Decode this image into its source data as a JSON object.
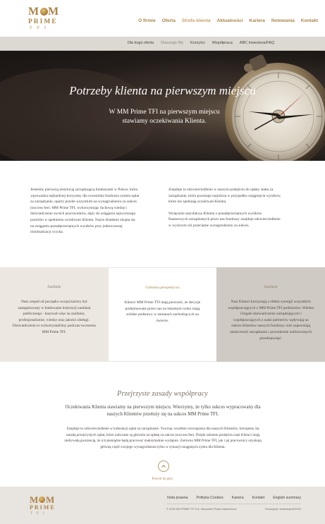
{
  "brand": {
    "logo_m": "M",
    "logo_prime": "PRIME",
    "logo_tfi": "TFI"
  },
  "nav": {
    "items": [
      "O firmie",
      "Oferta",
      "Strefa klienta",
      "Aktualności",
      "Kariera",
      "Notowania",
      "Kontakt"
    ],
    "active": "Strefa klienta"
  },
  "subnav": {
    "items": [
      "Dla kogo oferta",
      "Dlaczego My",
      "Korzyści",
      "Współpraca",
      "ABC Inwestora/FAQ"
    ],
    "active": "Dlaczego My"
  },
  "hero": {
    "title": "Potrzeby klienta na pierwszym miejscu",
    "subtitle": "W MM Prime TFI na pierwszym miejscu stawiamy oczekiwania Klienta."
  },
  "intro": {
    "left": "Jesteśmy pierwszą instytucją zarządzającą funduszami w Polsce, która wprowadza najbardziej korzystny dla uczestnika funduszu system opłat za zarządzanie, oparty przede wszystkim na wynagrodzeniu za sukces (success fee). MM Prime TFI, wykorzystując fachową wiedzę i doświadczenie swoich pracowników, dąży do osiągania najwyższego poziomu w spełnieniu oczekiwań Klienta. Nasze działanie skupia się na osiąganiu ponadprzeciętnych wyników przy jednoczesnej minimalizacji ryzyka.",
    "right_1": "Znajduje to odzwierciedlenie w naszym podejściu do opłaty stałej za zarządzanie, która pozostaje najniższa w przypadku osiągnięcia wyników, które nie spełniają oczekiwań Klienta.",
    "right_2": "Wyłącznie satysfakcja Klienta z ponadprzeciętnych wyników finansowych zarządzanych przez nas funduszy znajduje odzwierciedlenie w wyższym niż przeciętne wynagrodzeniu za sukces."
  },
  "columns": [
    {
      "heading": "Zaufanie",
      "text": "Nasz zespół od początku swojej kariery był zaangażowany w budowanie instytucji zaufania publicznego - bazował więc na zaufaniu, profesjonalizmie, wiedzy oraz jakości obsługi. Doświadczenie to wykorzystaliśmy podczas tworzenia MM Prime TFI."
    },
    {
      "heading": "Globalna perspektywa",
      "text": "Klienci MM Prime TFI mają pewność, że decyzje podejmowane przez nas na lokalnym rynku mają solidne podstawy w zmianach zachodzących na świecie."
    },
    {
      "heading": "Zaufanie",
      "text": "Nasi Klienci korzystają z efektu synergii wszystkich współpracujących z MM Prime TFI podmiotów. Wiedza i bogate doświadczenie zarządzających i współpracujących z nami partnerów wpływają na sukces Klientów naszych funduszy oraz zapewniają skuteczność zarządzania i powodzenie realizowanych przedsięwzięć."
    }
  ],
  "cooperation": {
    "title": "Przejrzyste zasady współpracy",
    "lead": "Oczekiwania Klienta stawiamy na pierwszym miejscu. Wierzymy, że tylko sukces wypracowany dla naszych Klientów przełoży się na sukces MM Prime TFI.",
    "body": "Znajduje to odzwierciedlenie w kalkulacji opłat za zarządzanie. Tworząc wszelkie rozwiązania dla naszych Klientów, kierujemy się zasadą przejrzystych opłat, które naliczane są głównie na opłatę za sukces (success fee). Dzięki takiemu podejściu nasi Klienci mają niebywałą gwarancję, że ich pieniądze będą pracować maksymalnie wydajnie. Zarówno MM Prime TFI, jak i jej pracownicy uzyskują główną część swojego wynagrodzenia tylko w sytuacji osiągnięcia zysku dla Klienta."
  },
  "back_to_top": {
    "label": "Powrót do góry",
    "icon": "chevron-up-icon"
  },
  "footer": {
    "links": [
      "Nota prawna",
      "Polityka Cookies",
      "Kariera",
      "Kontakt",
      "English summary"
    ],
    "copyright": "© 2015 MM PRIME TFI S.A. Wszystkie Prawa Zastrzeżone",
    "credit": "Koncepcja i realizacja ADVOX"
  },
  "colors": {
    "gold": "#a9834a",
    "subnav_bg": "#dcd8d2",
    "beige": "#ece7e1",
    "grey": "#cfcac4",
    "footer_bg": "#e8e4df"
  }
}
